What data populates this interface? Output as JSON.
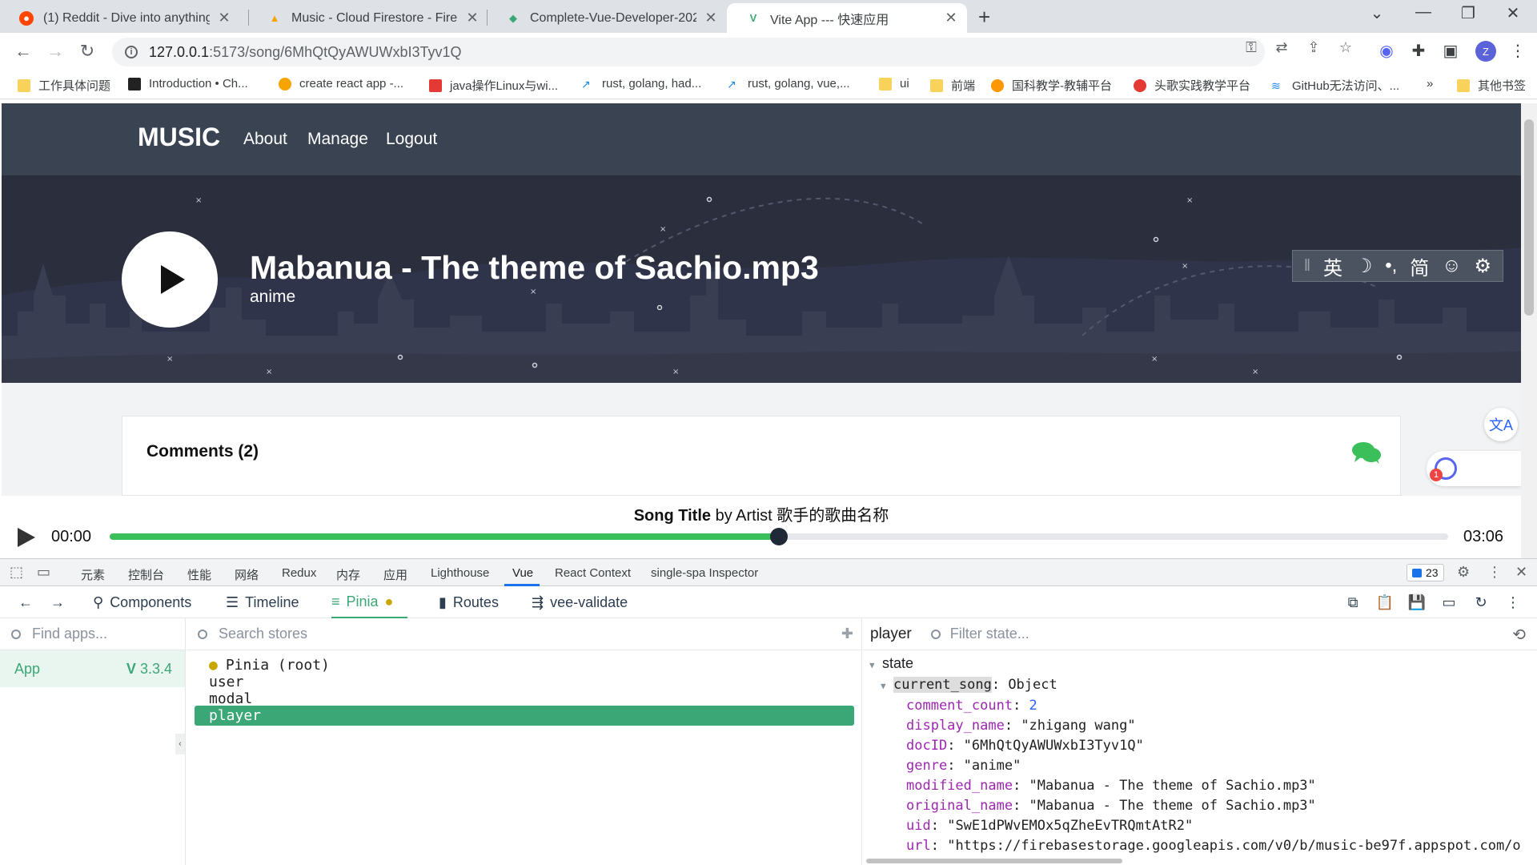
{
  "browser": {
    "tabs": [
      {
        "title": "(1) Reddit - Dive into anything",
        "active": false
      },
      {
        "title": "Music - Cloud Firestore - Fireb",
        "active": false
      },
      {
        "title": "Complete-Vue-Developer-202",
        "active": false
      },
      {
        "title": "Vite App --- 快速应用",
        "active": true
      }
    ],
    "url_host": "127.0.0.1",
    "url_path": ":5173/song/6MhQtQyAWUWxbI3Tyv1Q",
    "profile_initial": "Z",
    "bookmarks": [
      {
        "label": "工作具体问题",
        "icon": "folder"
      },
      {
        "label": "Introduction • Ch...",
        "icon": "page"
      },
      {
        "label": "create react app -...",
        "icon": "page"
      },
      {
        "label": "java操作Linux与wi...",
        "icon": "page"
      },
      {
        "label": "rust, golang, had...",
        "icon": "trend"
      },
      {
        "label": "rust, golang, vue,...",
        "icon": "trend"
      },
      {
        "label": "ui",
        "icon": "folder"
      },
      {
        "label": "前端",
        "icon": "folder"
      },
      {
        "label": "国科教学-教辅平台",
        "icon": "page"
      },
      {
        "label": "头歌实践教学平台",
        "icon": "page"
      },
      {
        "label": "GitHub无法访问、...",
        "icon": "page"
      },
      {
        "label": "»",
        "icon": "none"
      },
      {
        "label": "其他书签",
        "icon": "folder"
      }
    ]
  },
  "app": {
    "brand": "MUSIC",
    "nav": [
      "About",
      "Manage",
      "Logout"
    ],
    "song_title": "Mabanua - The theme of Sachio.mp3",
    "song_genre": "anime",
    "ime_toolbar": [
      "英",
      "☽",
      "•,",
      "简",
      "☺",
      "⚙"
    ],
    "comments_title": "Comments (2)",
    "player": {
      "now_playing_title": "Song Title",
      "now_playing_by": "by",
      "now_playing_artist": "Artist 歌手的歌曲名称",
      "current_time": "00:00",
      "duration": "03:06",
      "progress": 0.5
    },
    "colors": {
      "header": "#394352",
      "hero": "#2b2e3c",
      "progress": "#3bbf5a",
      "accent": "#3ba776"
    }
  },
  "devtools": {
    "tabs": [
      "元素",
      "控制台",
      "性能",
      "网络",
      "Redux",
      "内存",
      "应用",
      "Lighthouse",
      "Vue",
      "React Context",
      "single-spa Inspector"
    ],
    "active_tab": "Vue",
    "issues_count": "23",
    "vue_tabs": [
      "Components",
      "Timeline",
      "Pinia",
      "Routes",
      "vee-validate"
    ],
    "vue_active_tab": "Pinia",
    "find_apps_placeholder": "Find apps...",
    "app_name": "App",
    "app_version": "3.3.4",
    "search_stores_placeholder": "Search stores",
    "stores": [
      "Pinia (root)",
      "user",
      "modal",
      "player"
    ],
    "selected_store": "player",
    "state_store": "player",
    "filter_state_placeholder": "Filter state...",
    "state": {
      "root_label": "state",
      "object_key": "current_song",
      "object_type": "Object",
      "fields": [
        {
          "key": "comment_count",
          "value": "2",
          "kind": "num"
        },
        {
          "key": "display_name",
          "value": "\"zhigang wang\"",
          "kind": "str"
        },
        {
          "key": "docID",
          "value": "\"6MhQtQyAWUWxbI3Tyv1Q\"",
          "kind": "str"
        },
        {
          "key": "genre",
          "value": "\"anime\"",
          "kind": "str"
        },
        {
          "key": "modified_name",
          "value": "\"Mabanua - The theme of Sachio.mp3\"",
          "kind": "str"
        },
        {
          "key": "original_name",
          "value": "\"Mabanua - The theme of Sachio.mp3\"",
          "kind": "str"
        },
        {
          "key": "uid",
          "value": "\"SwE1dPWvEMOx5qZheEvTRQmtAtR2\"",
          "kind": "str"
        },
        {
          "key": "url",
          "value": "\"https://firebasestorage.googleapis.com/v0/b/music-be97f.appspot.com/o",
          "kind": "str"
        }
      ]
    }
  }
}
